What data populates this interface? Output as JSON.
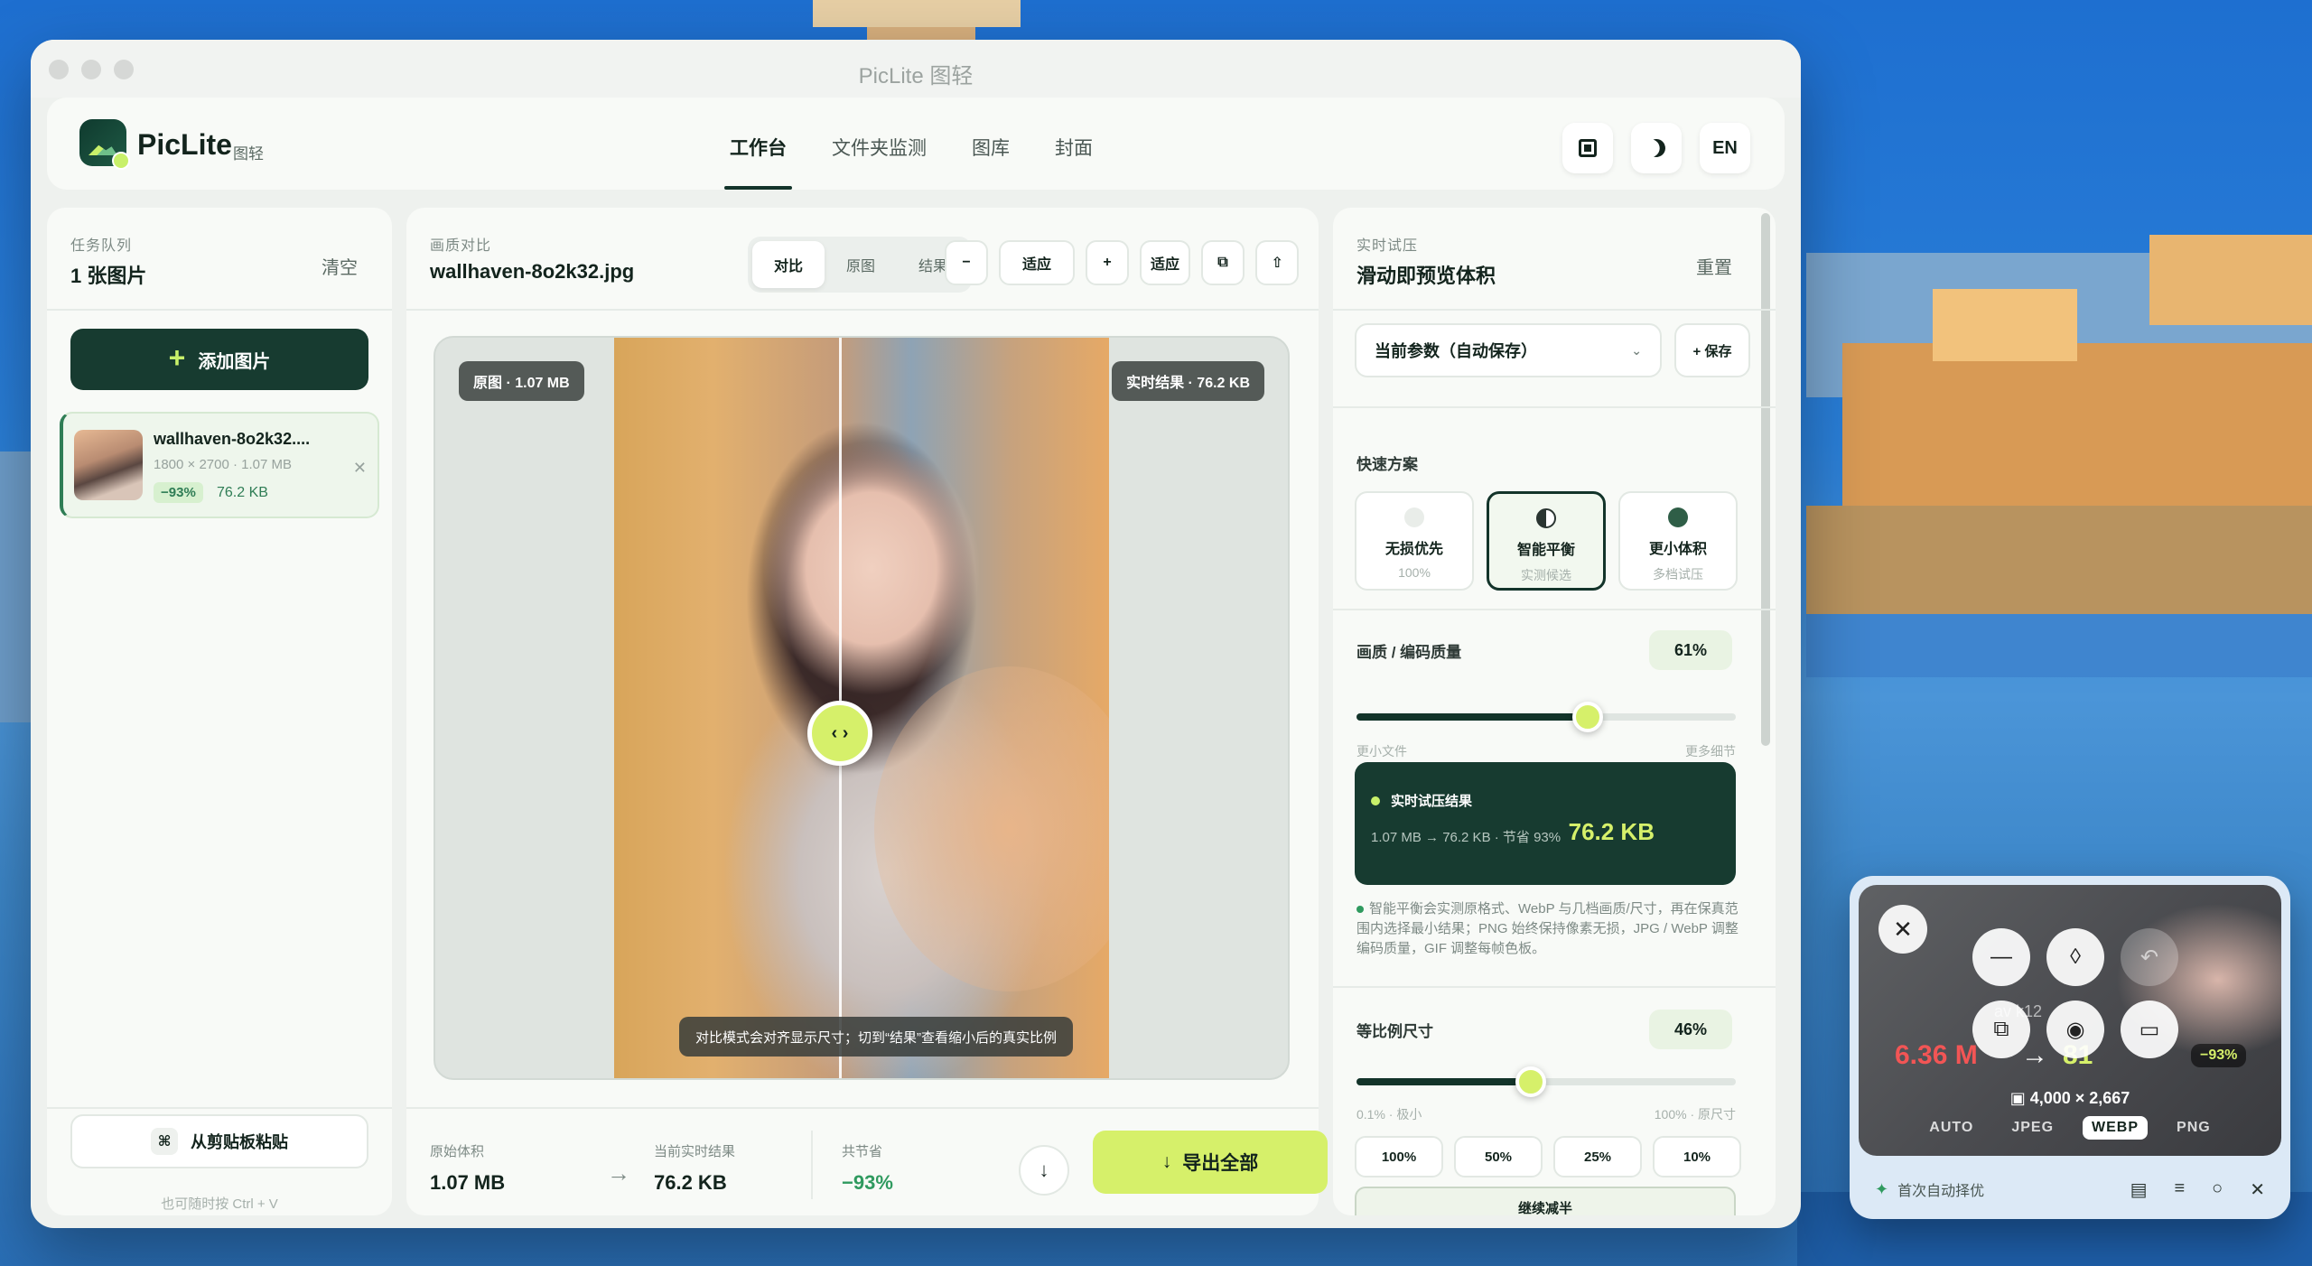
{
  "window": {
    "title": "PicLite 图轻"
  },
  "header": {
    "brand": "PicLite",
    "brand_sub": "图轻",
    "nav": [
      {
        "label": "工作台",
        "active": true
      },
      {
        "label": "文件夹监测",
        "active": false
      },
      {
        "label": "图库",
        "active": false
      },
      {
        "label": "封面",
        "active": false
      }
    ],
    "actions": {
      "theme_icon": "moon-icon",
      "layout_icon": "square-icon",
      "lang": "EN"
    }
  },
  "queue": {
    "label": "任务队列",
    "title": "1 张图片",
    "clear": "清空",
    "add_button": "添加图片",
    "file": {
      "name": "wallhaven-8o2k32....",
      "meta": "1800 × 2700 · 1.07 MB",
      "badge": "−93%",
      "size": "76.2 KB"
    },
    "paste_button": "从剪贴板粘贴",
    "paste_icon": "⌘",
    "paste_hint": "也可随时按 Ctrl + V"
  },
  "compare": {
    "label": "画质对比",
    "filename": "wallhaven-8o2k32.jpg",
    "modes": [
      "对比",
      "原图",
      "结果"
    ],
    "active_mode": "对比",
    "zoom": {
      "minus": "−",
      "fit1": "适应",
      "plus": "+",
      "fit2": "适应"
    },
    "tag_original": "原图 · 1.07 MB",
    "tag_result": "实时结果 · 76.2 KB",
    "hint": "对比模式会对齐显示尺寸；切到“结果”查看缩小后的真实比例",
    "stats": {
      "orig_label": "原始体积",
      "orig_value": "1.07 MB",
      "cur_label": "当前实时结果",
      "cur_value": "76.2 KB",
      "save_label": "共节省",
      "save_value": "−93%"
    },
    "export_button": "导出全部"
  },
  "trial": {
    "label": "实时试压",
    "title": "滑动即预览体积",
    "reset": "重置",
    "preset_select": "当前参数（自动保存）",
    "save_button": "+ 保存",
    "quick_label": "快速方案",
    "presets": [
      {
        "title": "无损优先",
        "sub": "100%",
        "active": false,
        "color": "#e9ede9"
      },
      {
        "title": "智能平衡",
        "sub": "实测候选",
        "active": true,
        "color": "#2a3531"
      },
      {
        "title": "更小体积",
        "sub": "多档试压",
        "active": false,
        "color": "#2f5e47"
      }
    ],
    "quality": {
      "label": "画质 / 编码质量",
      "value": "61%",
      "fraction": 0.61,
      "min_label": "更小文件",
      "max_label": "更多细节"
    },
    "result": {
      "title": "实时试压结果",
      "summary": "1.07 MB → 76.2 KB · 节省 93%",
      "value": "76.2 KB"
    },
    "note": "智能平衡会实测原格式、WebP 与几档画质/尺寸，再在保真范围内选择最小结果；PNG 始终保持像素无损，JPG / WebP 调整编码质量，GIF 调整每帧色板。",
    "scale": {
      "label": "等比例尺寸",
      "value": "46%",
      "fraction": 0.46,
      "min_label": "0.1% · 极小",
      "max_label": "100% · 原尺寸"
    },
    "ratios": [
      "100%",
      "50%",
      "25%",
      "10%"
    ],
    "half_button": "继续减半"
  },
  "mini": {
    "orig": "6.36 M",
    "arrow": "→",
    "new": "81",
    "pct": "−93%",
    "file": "av k12",
    "dims": "4,000 × 2,667",
    "formats": [
      "AUTO",
      "JPEG",
      "WEBP",
      "PNG"
    ],
    "active_format": "WEBP",
    "bar_text": "首次自动择优"
  }
}
